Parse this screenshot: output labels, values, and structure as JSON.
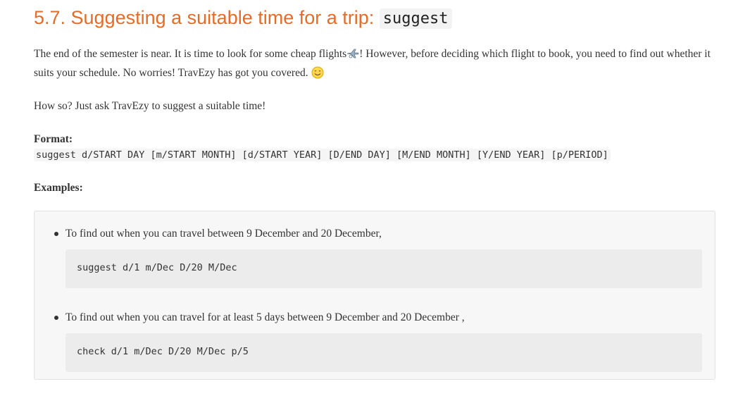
{
  "heading": {
    "number_and_text": "5.7. Suggesting a suitable time for a trip: ",
    "command": "suggest"
  },
  "intro": {
    "text_part1": "The end of the semester is near. It is time to look for some cheap flights",
    "text_part2": "! However, before deciding which flight to book, you need to find out whether it suits your schedule. No worries! TravEzy has got you covered.",
    "icon_plane": "airplane-emoji",
    "icon_smile": "smiling-face-emoji"
  },
  "howso": "How so? Just ask TravEzy to suggest a suitable time!",
  "format": {
    "label": "Format:",
    "code": "suggest d/START DAY [m/START MONTH] [d/START YEAR] [D/END DAY] [M/END MONTH] [Y/END YEAR] [p/PERIOD]"
  },
  "examples": {
    "label": "Examples:",
    "items": [
      {
        "description": "To find out when you can travel between 9 December and 20 December,",
        "code": "suggest d/1 m/Dec D/20 M/Dec"
      },
      {
        "description": "To find out when you can travel for at least 5 days between 9 December and 20 December ,",
        "code": "check d/1 m/Dec D/20 M/Dec p/5"
      }
    ]
  },
  "colors": {
    "heading": "#e46c28",
    "text": "#333333",
    "code_bg": "#ececec",
    "box_bg": "#f7f7f7"
  }
}
